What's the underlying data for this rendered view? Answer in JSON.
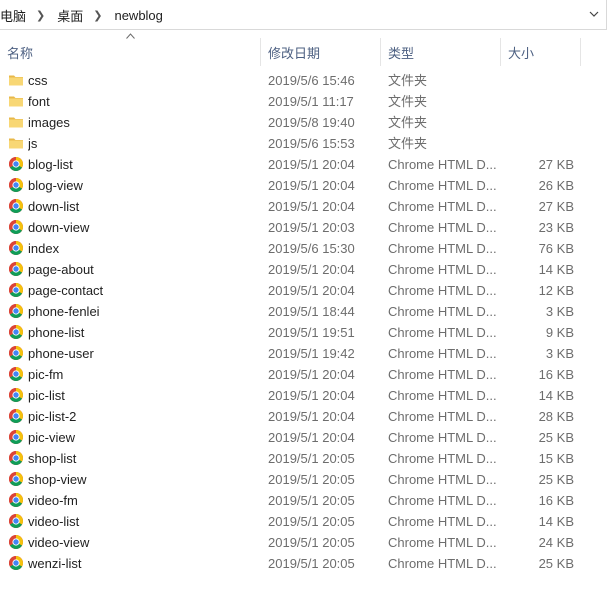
{
  "breadcrumb": {
    "items": [
      "电脑",
      "桌面",
      "newblog"
    ]
  },
  "columns": {
    "name": "名称",
    "date": "修改日期",
    "type": "类型",
    "size": "大小"
  },
  "sort": {
    "column": "name",
    "direction": "ascending"
  },
  "colors": {
    "folder": "#f8d775",
    "folder_dark": "#e8b84a",
    "header_text": "#4d6082",
    "secondary_text": "#6d6d6d"
  },
  "files": [
    {
      "icon": "folder-icon",
      "name": "css",
      "date": "2019/5/6 15:46",
      "type": "文件夹",
      "size": ""
    },
    {
      "icon": "folder-icon",
      "name": "font",
      "date": "2019/5/1 11:17",
      "type": "文件夹",
      "size": ""
    },
    {
      "icon": "folder-icon",
      "name": "images",
      "date": "2019/5/8 19:40",
      "type": "文件夹",
      "size": ""
    },
    {
      "icon": "folder-icon",
      "name": "js",
      "date": "2019/5/6 15:53",
      "type": "文件夹",
      "size": ""
    },
    {
      "icon": "chrome-icon",
      "name": "blog-list",
      "date": "2019/5/1 20:04",
      "type": "Chrome HTML D...",
      "size": "27 KB"
    },
    {
      "icon": "chrome-icon",
      "name": "blog-view",
      "date": "2019/5/1 20:04",
      "type": "Chrome HTML D...",
      "size": "26 KB"
    },
    {
      "icon": "chrome-icon",
      "name": "down-list",
      "date": "2019/5/1 20:04",
      "type": "Chrome HTML D...",
      "size": "27 KB"
    },
    {
      "icon": "chrome-icon",
      "name": "down-view",
      "date": "2019/5/1 20:03",
      "type": "Chrome HTML D...",
      "size": "23 KB"
    },
    {
      "icon": "chrome-icon",
      "name": "index",
      "date": "2019/5/6 15:30",
      "type": "Chrome HTML D...",
      "size": "76 KB"
    },
    {
      "icon": "chrome-icon",
      "name": "page-about",
      "date": "2019/5/1 20:04",
      "type": "Chrome HTML D...",
      "size": "14 KB"
    },
    {
      "icon": "chrome-icon",
      "name": "page-contact",
      "date": "2019/5/1 20:04",
      "type": "Chrome HTML D...",
      "size": "12 KB"
    },
    {
      "icon": "chrome-icon",
      "name": "phone-fenlei",
      "date": "2019/5/1 18:44",
      "type": "Chrome HTML D...",
      "size": "3 KB"
    },
    {
      "icon": "chrome-icon",
      "name": "phone-list",
      "date": "2019/5/1 19:51",
      "type": "Chrome HTML D...",
      "size": "9 KB"
    },
    {
      "icon": "chrome-icon",
      "name": "phone-user",
      "date": "2019/5/1 19:42",
      "type": "Chrome HTML D...",
      "size": "3 KB"
    },
    {
      "icon": "chrome-icon",
      "name": "pic-fm",
      "date": "2019/5/1 20:04",
      "type": "Chrome HTML D...",
      "size": "16 KB"
    },
    {
      "icon": "chrome-icon",
      "name": "pic-list",
      "date": "2019/5/1 20:04",
      "type": "Chrome HTML D...",
      "size": "14 KB"
    },
    {
      "icon": "chrome-icon",
      "name": "pic-list-2",
      "date": "2019/5/1 20:04",
      "type": "Chrome HTML D...",
      "size": "28 KB"
    },
    {
      "icon": "chrome-icon",
      "name": "pic-view",
      "date": "2019/5/1 20:04",
      "type": "Chrome HTML D...",
      "size": "25 KB"
    },
    {
      "icon": "chrome-icon",
      "name": "shop-list",
      "date": "2019/5/1 20:05",
      "type": "Chrome HTML D...",
      "size": "15 KB"
    },
    {
      "icon": "chrome-icon",
      "name": "shop-view",
      "date": "2019/5/1 20:05",
      "type": "Chrome HTML D...",
      "size": "25 KB"
    },
    {
      "icon": "chrome-icon",
      "name": "video-fm",
      "date": "2019/5/1 20:05",
      "type": "Chrome HTML D...",
      "size": "16 KB"
    },
    {
      "icon": "chrome-icon",
      "name": "video-list",
      "date": "2019/5/1 20:05",
      "type": "Chrome HTML D...",
      "size": "14 KB"
    },
    {
      "icon": "chrome-icon",
      "name": "video-view",
      "date": "2019/5/1 20:05",
      "type": "Chrome HTML D...",
      "size": "24 KB"
    },
    {
      "icon": "chrome-icon",
      "name": "wenzi-list",
      "date": "2019/5/1 20:05",
      "type": "Chrome HTML D...",
      "size": "25 KB"
    }
  ]
}
